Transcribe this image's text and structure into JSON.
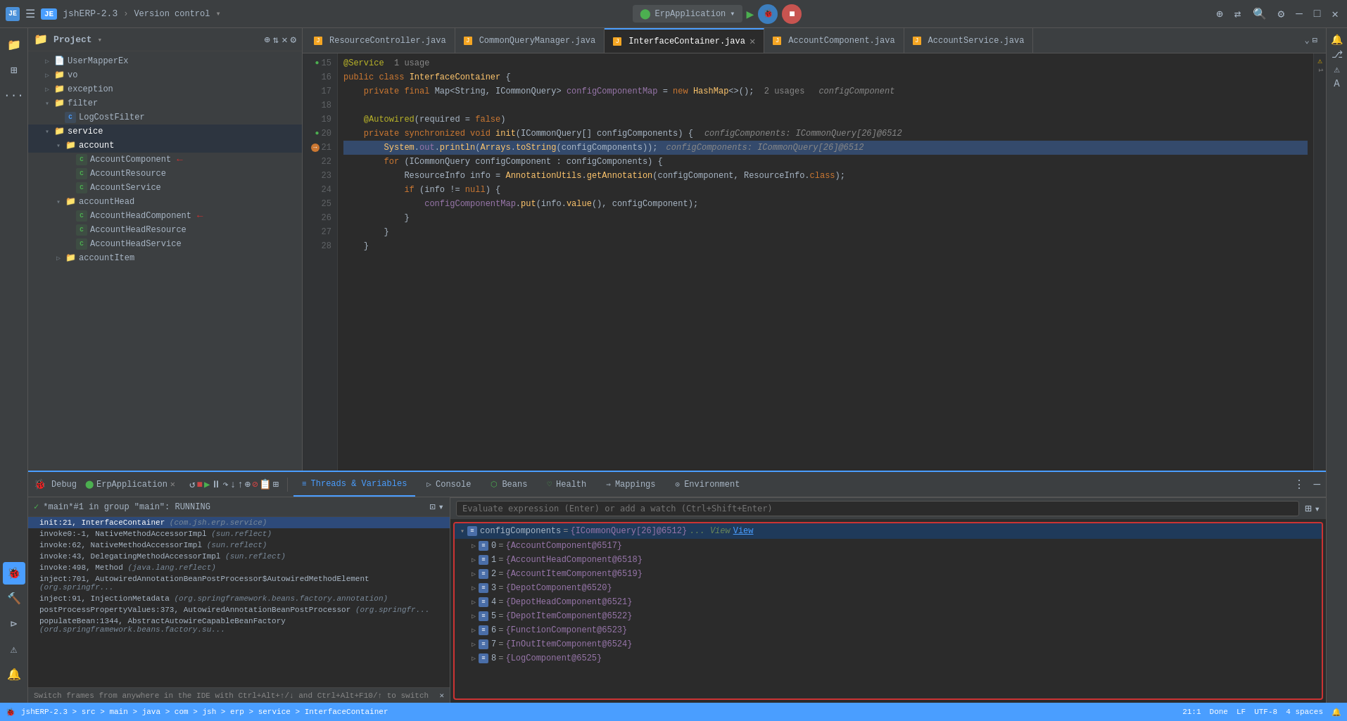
{
  "titleBar": {
    "appIcon": "JE",
    "projectName": "jshERP-2.3",
    "versionControl": "Version control",
    "runConfig": "ErpApplication",
    "hamburgerLabel": "☰",
    "windowControls": [
      "—",
      "□",
      "✕"
    ]
  },
  "fileTree": {
    "title": "Project",
    "items": [
      {
        "label": "UserMapperEx",
        "type": "class",
        "indent": 1
      },
      {
        "label": "vo",
        "type": "folder",
        "indent": 1
      },
      {
        "label": "exception",
        "type": "folder",
        "indent": 1
      },
      {
        "label": "filter",
        "type": "folder",
        "indent": 1
      },
      {
        "label": "LogCostFilter",
        "type": "class",
        "indent": 2
      },
      {
        "label": "service",
        "type": "folder",
        "indent": 1,
        "highlighted": true
      },
      {
        "label": "account",
        "type": "folder",
        "indent": 2,
        "highlighted": true
      },
      {
        "label": "AccountComponent",
        "type": "class",
        "indent": 3
      },
      {
        "label": "AccountResource",
        "type": "class",
        "indent": 3
      },
      {
        "label": "AccountService",
        "type": "class",
        "indent": 3
      },
      {
        "label": "accountHead",
        "type": "folder",
        "indent": 2
      },
      {
        "label": "AccountHeadComponent",
        "type": "class",
        "indent": 3
      },
      {
        "label": "AccountHeadResource",
        "type": "class",
        "indent": 3
      },
      {
        "label": "AccountHeadService",
        "type": "class",
        "indent": 3
      },
      {
        "label": "accountItem",
        "type": "folder",
        "indent": 2
      }
    ]
  },
  "tabs": [
    {
      "label": "ResourceController.java",
      "active": false,
      "modified": false
    },
    {
      "label": "CommonQueryManager.java",
      "active": false,
      "modified": false
    },
    {
      "label": "InterfaceContainer.java",
      "active": true,
      "modified": false
    },
    {
      "label": "AccountComponent.java",
      "active": false,
      "modified": false
    },
    {
      "label": "AccountService.java",
      "active": false,
      "modified": false
    }
  ],
  "editor": {
    "lines": [
      {
        "num": 15,
        "content": "@Service  1 usage",
        "type": "annotation"
      },
      {
        "num": 16,
        "content": "public class InterfaceContainer {",
        "type": "normal"
      },
      {
        "num": 17,
        "content": "    private final Map<String, ICommonQuery> configComponentMap = new HashMap<>();  2 usages",
        "type": "normal"
      },
      {
        "num": 18,
        "content": "",
        "type": "empty"
      },
      {
        "num": 19,
        "content": "    @Autowired(required = false)",
        "type": "annotation"
      },
      {
        "num": 20,
        "content": "    private synchronized void init(ICommonQuery[] configComponents) {",
        "type": "normal"
      },
      {
        "num": 21,
        "content": "        System.out.println(Arrays.toString(configComponents));",
        "type": "highlighted"
      },
      {
        "num": 22,
        "content": "        for (ICommonQuery configComponent : configComponents) {",
        "type": "normal"
      },
      {
        "num": 23,
        "content": "            ResourceInfo info = AnnotationUtils.getAnnotation(configComponent, ResourceInfo.class);",
        "type": "normal"
      },
      {
        "num": 24,
        "content": "            if (info != null) {",
        "type": "normal"
      },
      {
        "num": 25,
        "content": "                configComponentMap.put(info.value(), configComponent);",
        "type": "normal"
      },
      {
        "num": 26,
        "content": "            }",
        "type": "normal"
      },
      {
        "num": 27,
        "content": "        }",
        "type": "normal"
      },
      {
        "num": 28,
        "content": "    }",
        "type": "normal"
      }
    ]
  },
  "debugPanel": {
    "title": "Debug",
    "appLabel": "ErpApplication",
    "tabs": [
      {
        "label": "Threads & Variables",
        "active": true,
        "icon": "threads"
      },
      {
        "label": "Console",
        "active": false,
        "icon": "console"
      },
      {
        "label": "Beans",
        "active": false,
        "icon": "beans"
      },
      {
        "label": "Health",
        "active": false,
        "icon": "health"
      },
      {
        "label": "Mappings",
        "active": false,
        "icon": "mappings"
      },
      {
        "label": "Environment",
        "active": false,
        "icon": "environment"
      }
    ],
    "thread": {
      "label": "*main*#1 in group \"main\": RUNNING",
      "frames": [
        {
          "label": "init:21, InterfaceContainer (com.jsh.erp.service)",
          "selected": true
        },
        {
          "label": "invoke0:-1, NativeMethodAccessorImpl (sun.reflect)",
          "italic": true
        },
        {
          "label": "invoke:62, NativeMethodAccessorImpl (sun.reflect)",
          "italic": true
        },
        {
          "label": "invoke:43, DelegatingMethodAccessorImpl (sun.reflect)",
          "italic": true
        },
        {
          "label": "invoke:498, Method (java.lang.reflect)",
          "italic": true
        },
        {
          "label": "inject:701, AutowiredAnnotationBeanPostProcessor$AutowiredMethodElement (org.springfr..."
        },
        {
          "label": "inject:91, InjectionMetadata (org.springframework.beans.factory.annotation)"
        },
        {
          "label": "postProcessPropertyValues:373, AutowiredAnnotationBeanPostProcessor (org.springfr..."
        },
        {
          "label": "populateBean:1344, AbstractAutowireCapableBeanFactory (org.springframework.beans.factory.su..."
        }
      ]
    },
    "evalBar": {
      "placeholder": "Evaluate expression (Enter) or add a watch (Ctrl+Shift+Enter)"
    },
    "variables": {
      "root": {
        "name": "configComponents",
        "value": "{ICommonQuery[26]@6512}",
        "extra": "... View",
        "children": [
          {
            "index": "0",
            "value": "{AccountComponent@6517}"
          },
          {
            "index": "1",
            "value": "{AccountHeadComponent@6518}"
          },
          {
            "index": "2",
            "value": "{AccountItemComponent@6519}"
          },
          {
            "index": "3",
            "value": "{DepotComponent@6520}"
          },
          {
            "index": "4",
            "value": "{DepotHeadComponent@6521}"
          },
          {
            "index": "5",
            "value": "{DepotItemComponent@6522}"
          },
          {
            "index": "6",
            "value": "{FunctionComponent@6523}"
          },
          {
            "index": "7",
            "value": "{InOutItemComponent@6524}"
          },
          {
            "index": "8",
            "value": "{LogComponent@6525}"
          }
        ]
      }
    }
  },
  "statusBar": {
    "projectPath": "jshERP-2.3 > src > main > java > com > jsh > erp > service > InterfaceContainer",
    "position": "21:1",
    "encoding": "UTF-8",
    "indent": "4 spaces",
    "lineEnding": "LF",
    "status": "Done"
  },
  "hints": {
    "switchFrames": "Switch frames from anywhere in the IDE with Ctrl+Alt+↑/↓ and Ctrl+Alt+F10/↑ to switch"
  }
}
